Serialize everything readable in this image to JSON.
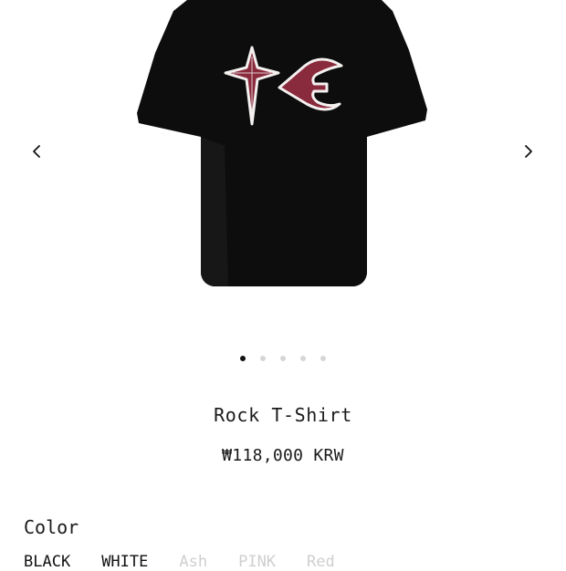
{
  "product": {
    "name": "Rock T-Shirt",
    "price": "₩118,000 KRW"
  },
  "gallery": {
    "dots": [
      {
        "active": true
      },
      {
        "active": false
      },
      {
        "active": false
      },
      {
        "active": false
      },
      {
        "active": false
      }
    ]
  },
  "icons": {
    "prev": "chevron-left-icon",
    "next": "chevron-right-icon"
  },
  "options": {
    "color_label": "Color",
    "colors": [
      "BLACK",
      "WHITE",
      "Ash",
      "PINK",
      "Red"
    ]
  },
  "colors": {
    "shirt": "#0d0d0d",
    "graphic": "#8a2a3d",
    "graphic_outline": "#f3f0ef",
    "dot_active": "#111111",
    "dot_inactive": "#d6d6d6"
  }
}
